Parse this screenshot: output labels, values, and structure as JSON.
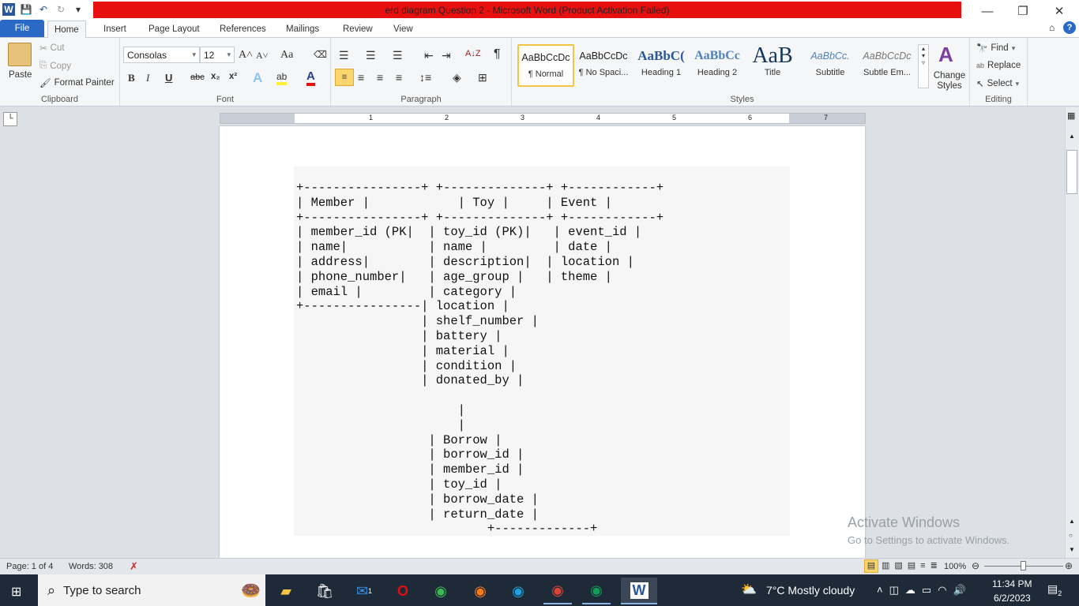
{
  "window": {
    "title": "erd diagram Question 2  -  Microsoft Word (Product Activation Failed)",
    "minimize": "—",
    "restore": "❐",
    "close": "✕"
  },
  "qat": {
    "word_icon": "W",
    "save_icon": "💾",
    "undo_icon": "↶",
    "redo_icon": "↻",
    "customize_icon": "▾"
  },
  "tabs": [
    "File",
    "Home",
    "Insert",
    "Page Layout",
    "References",
    "Mailings",
    "Review",
    "View"
  ],
  "ribbon": {
    "clipboard": {
      "label": "Clipboard",
      "paste": "Paste",
      "cut": "Cut",
      "copy": "Copy",
      "format_painter": "Format Painter"
    },
    "font": {
      "label": "Font",
      "font_name": "Consolas",
      "font_size": "12",
      "bold": "B",
      "italic": "I",
      "underline": "U",
      "strike": "abc",
      "subscript": "x₂",
      "superscript": "x²",
      "grow": "A˄",
      "shrink": "A˅",
      "case": "Aa",
      "highlight": "ab",
      "color": "A",
      "effects": "A"
    },
    "paragraph": {
      "label": "Paragraph",
      "pilcrow": "¶",
      "sort": "A↓Z"
    },
    "styles": {
      "label": "Styles",
      "items": [
        {
          "preview": "AaBbCcDc",
          "name": "¶ Normal"
        },
        {
          "preview": "AaBbCcDc",
          "name": "¶ No Spaci..."
        },
        {
          "preview": "AaBbC(",
          "name": "Heading 1"
        },
        {
          "preview": "AaBbCc",
          "name": "Heading 2"
        },
        {
          "preview": "AaB",
          "name": "Title"
        },
        {
          "preview": "AaBbCc.",
          "name": "Subtitle"
        },
        {
          "preview": "AaBbCcDc",
          "name": "Subtle Em..."
        }
      ],
      "change_styles": "Change Styles"
    },
    "editing": {
      "label": "Editing",
      "find": "Find",
      "replace": "Replace",
      "select": "Select"
    }
  },
  "document": {
    "lines": [
      "+----------------+ +--------------+ +------------+",
      "| Member |            | Toy |     | Event |",
      "+----------------+ +--------------+ +------------+",
      "| member_id (PK|  | toy_id (PK)|   | event_id |",
      "| name|           | name |         | date |",
      "| address|        | description|  | location |",
      "| phone_number|   | age_group |   | theme |",
      "| email |         | category |",
      "+----------------| location |",
      "                 | shelf_number |",
      "                 | battery |",
      "                 | material |",
      "                 | condition |",
      "                 | donated_by |",
      "",
      "                      |",
      "                      |",
      "                  | Borrow |",
      "                  | borrow_id |",
      "                  | member_id |",
      "                  | toy_id |",
      "                  | borrow_date |",
      "                  | return_date |",
      "                          +-------------+"
    ]
  },
  "ruler_marks": [
    "1",
    "2",
    "3",
    "4",
    "5",
    "6",
    "7"
  ],
  "watermark": {
    "line1": "Activate Windows",
    "line2": "Go to Settings to activate Windows."
  },
  "status": {
    "page": "Page: 1 of 4",
    "words": "Words: 308",
    "zoom": "100%"
  },
  "taskbar": {
    "search_placeholder": "Type to search",
    "weather": "7°C  Mostly cloudy",
    "time": "11:34 PM",
    "date": "6/2/2023",
    "notifications": "2",
    "mail_badge": "1"
  }
}
